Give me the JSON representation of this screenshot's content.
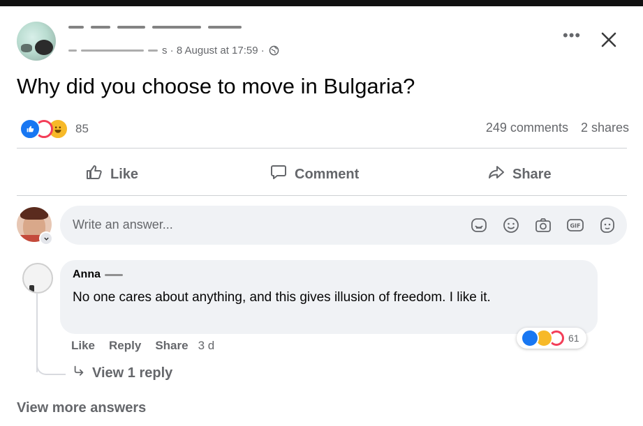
{
  "post": {
    "author_redacted": "",
    "meta_date": "s · 8 August at 17:59 ·",
    "title": "Why did you choose to move in Bulgaria?",
    "reaction_count": "85",
    "comments": "249 comments",
    "shares": "2 shares"
  },
  "actions": {
    "like": "Like",
    "comment": "Comment",
    "share": "Share"
  },
  "composer": {
    "placeholder": "Write an answer..."
  },
  "comment": {
    "author": "Anna",
    "text": "No one cares about anything, and this gives illusion of freedom. I like it.",
    "reaction_count": "61",
    "like": "Like",
    "reply": "Reply",
    "share": "Share",
    "time": "3 d",
    "view_reply": "View 1 reply"
  },
  "footer": {
    "view_more": "View more answers"
  },
  "colors": {
    "like_blue": "#1877f2",
    "love_red": "#f33e58",
    "haha_yellow": "#f7b928",
    "secondary_text": "#65676b",
    "bubble_bg": "#f0f2f5"
  },
  "icons": [
    "globe-icon",
    "more-icon",
    "close-icon",
    "like-icon",
    "comment-icon",
    "share-icon",
    "sticker-icon",
    "emoji-icon",
    "camera-icon",
    "gif-icon",
    "avatar-sticker-icon",
    "reply-arrow-icon"
  ]
}
